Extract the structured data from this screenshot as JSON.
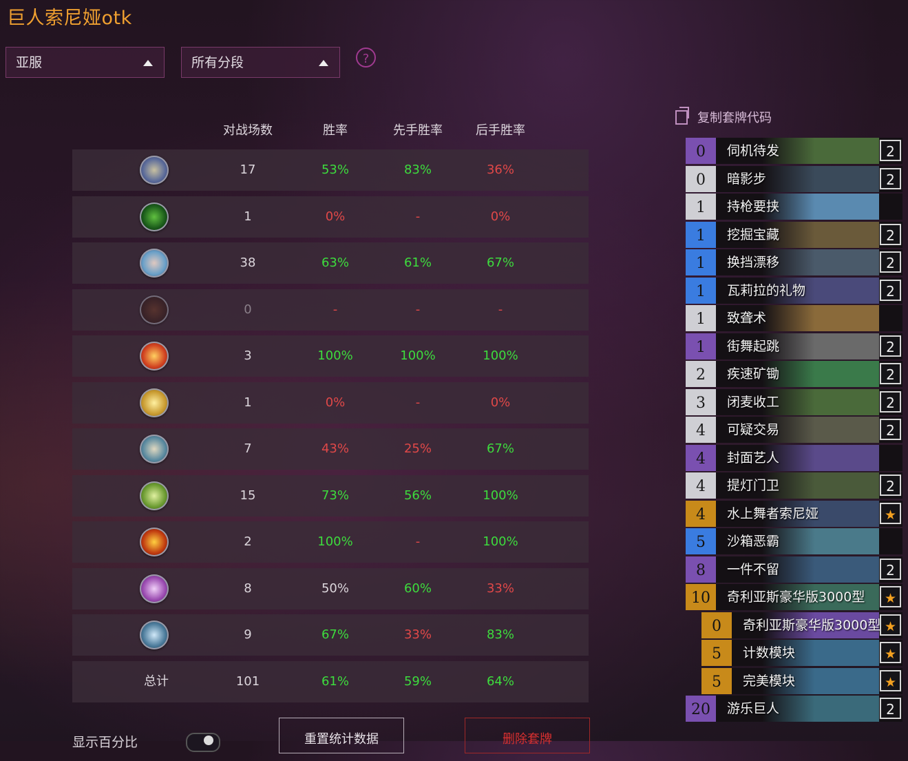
{
  "title": "巨人索尼娅otk",
  "filters": {
    "region": "亚服",
    "rank": "所有分段",
    "help": "?"
  },
  "table": {
    "headers": [
      "对战场数",
      "胜率",
      "先手胜率",
      "后手胜率"
    ],
    "rows": [
      {
        "class": "demon-hunter",
        "games": "17",
        "wr": "53%",
        "first": "83%",
        "second": "36%",
        "colors": [
          "g",
          "g",
          "r"
        ]
      },
      {
        "class": "druid",
        "games": "1",
        "wr": "0%",
        "first": "-",
        "second": "0%",
        "colors": [
          "r",
          "r",
          "r"
        ]
      },
      {
        "class": "death-knight",
        "games": "38",
        "wr": "63%",
        "first": "61%",
        "second": "67%",
        "colors": [
          "g",
          "g",
          "g"
        ]
      },
      {
        "class": "hunter",
        "games": "0",
        "wr": "-",
        "first": "-",
        "second": "-",
        "colors": [
          "r",
          "r",
          "r"
        ]
      },
      {
        "class": "mage",
        "games": "3",
        "wr": "100%",
        "first": "100%",
        "second": "100%",
        "colors": [
          "g",
          "g",
          "g"
        ]
      },
      {
        "class": "paladin",
        "games": "1",
        "wr": "0%",
        "first": "-",
        "second": "0%",
        "colors": [
          "r",
          "r",
          "r"
        ]
      },
      {
        "class": "priest",
        "games": "7",
        "wr": "43%",
        "first": "25%",
        "second": "67%",
        "colors": [
          "r",
          "r",
          "g"
        ]
      },
      {
        "class": "shaman",
        "games": "15",
        "wr": "73%",
        "first": "56%",
        "second": "100%",
        "colors": [
          "g",
          "g",
          "g"
        ]
      },
      {
        "class": "warlock",
        "games": "2",
        "wr": "100%",
        "first": "-",
        "second": "100%",
        "colors": [
          "g",
          "r",
          "g"
        ]
      },
      {
        "class": "rogue",
        "games": "8",
        "wr": "50%",
        "first": "60%",
        "second": "33%",
        "colors": [
          "w",
          "g",
          "r"
        ]
      },
      {
        "class": "warrior",
        "games": "9",
        "wr": "67%",
        "first": "33%",
        "second": "83%",
        "colors": [
          "g",
          "r",
          "g"
        ]
      }
    ],
    "total": {
      "label": "总计",
      "games": "101",
      "wr": "61%",
      "first": "59%",
      "second": "64%"
    }
  },
  "deck": {
    "copy_label": "复制套牌代码",
    "cards": [
      {
        "cost": "0",
        "name": "伺机待发",
        "count": "2",
        "rarity": "epic",
        "art": "#4a6a3a"
      },
      {
        "cost": "0",
        "name": "暗影步",
        "count": "2",
        "rarity": "common",
        "art": "#3a4a5a"
      },
      {
        "cost": "1",
        "name": "持枪要挟",
        "count": "",
        "rarity": "common",
        "art": "#5a8ab0"
      },
      {
        "cost": "1",
        "name": "挖掘宝藏",
        "count": "2",
        "rarity": "rare",
        "art": "#6a5a3a"
      },
      {
        "cost": "1",
        "name": "换挡漂移",
        "count": "2",
        "rarity": "rare",
        "art": "#4a5a6a"
      },
      {
        "cost": "1",
        "name": "瓦莉拉的礼物",
        "count": "2",
        "rarity": "rare",
        "art": "#4a4a7a"
      },
      {
        "cost": "1",
        "name": "致聋术",
        "count": "",
        "rarity": "common",
        "art": "#8a6a3a"
      },
      {
        "cost": "1",
        "name": "街舞起跳",
        "count": "2",
        "rarity": "epic",
        "art": "#6a6a6a"
      },
      {
        "cost": "2",
        "name": "疾速矿锄",
        "count": "2",
        "rarity": "common",
        "art": "#3a7a4a"
      },
      {
        "cost": "3",
        "name": "闭麦收工",
        "count": "2",
        "rarity": "common",
        "art": "#4a6a3a"
      },
      {
        "cost": "4",
        "name": "可疑交易",
        "count": "2",
        "rarity": "common",
        "art": "#5a5a4a"
      },
      {
        "cost": "4",
        "name": "封面艺人",
        "count": "",
        "rarity": "epic",
        "art": "#5a4a8a"
      },
      {
        "cost": "4",
        "name": "提灯门卫",
        "count": "2",
        "rarity": "common",
        "art": "#4a5a3a"
      },
      {
        "cost": "4",
        "name": "水上舞者索尼娅",
        "count": "★",
        "rarity": "leg",
        "art": "#3a4a6a"
      },
      {
        "cost": "5",
        "name": "沙箱恶霸",
        "count": "",
        "rarity": "rare",
        "art": "#4a7a8a"
      },
      {
        "cost": "8",
        "name": "一件不留",
        "count": "2",
        "rarity": "epic",
        "art": "#3a5a7a"
      },
      {
        "cost": "10",
        "name": "奇利亚斯豪华版3000型",
        "count": "★",
        "rarity": "leg",
        "art": "#3a6a5a"
      },
      {
        "cost": "0",
        "name": "奇利亚斯豪华版3000型",
        "count": "★",
        "rarity": "leg",
        "art": "#6a4aa0",
        "sub": true
      },
      {
        "cost": "5",
        "name": "计数模块",
        "count": "★",
        "rarity": "leg",
        "art": "#3a6a8a",
        "sub": true
      },
      {
        "cost": "5",
        "name": "完美模块",
        "count": "★",
        "rarity": "leg",
        "art": "#3a6a8a",
        "sub": true
      },
      {
        "cost": "20",
        "name": "游乐巨人",
        "count": "2",
        "rarity": "epic",
        "art": "#3a6a7a"
      }
    ]
  },
  "bottom": {
    "show_percent": "显示百分比",
    "reset": "重置统计数据",
    "delete": "删除套牌"
  },
  "colors": {
    "title": "#f0a030",
    "win": "#3ddc3d",
    "loss": "#e04848"
  }
}
